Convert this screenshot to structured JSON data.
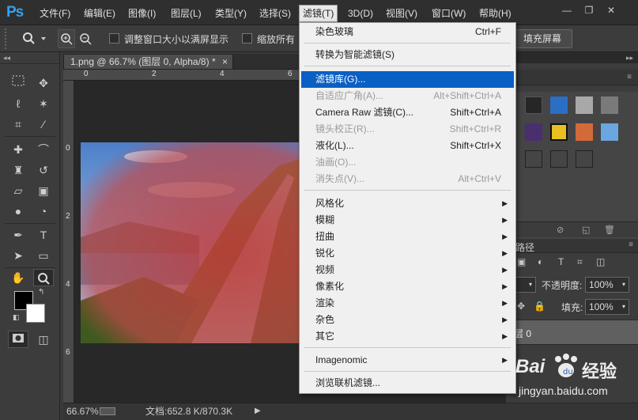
{
  "app": {
    "logo": "Ps"
  },
  "menubar": {
    "items": [
      {
        "label": "文件(F)"
      },
      {
        "label": "编辑(E)"
      },
      {
        "label": "图像(I)"
      },
      {
        "label": "图层(L)"
      },
      {
        "label": "类型(Y)"
      },
      {
        "label": "选择(S)"
      },
      {
        "label": "滤镜(T)",
        "active": true
      },
      {
        "label": "3D(D)"
      },
      {
        "label": "视图(V)"
      },
      {
        "label": "窗口(W)"
      },
      {
        "label": "帮助(H)"
      }
    ]
  },
  "window_controls": {
    "minimize": "—",
    "restore": "❐",
    "close": "✕"
  },
  "options": {
    "resize_window_label": "调整窗口大小以满屏显示",
    "zoom_all_label": "缩放所有",
    "fill_screen_label": "填充屏幕"
  },
  "document": {
    "tab_title": "1.png @ 66.7% (图层 0, Alpha/8) *",
    "tab_close": "×",
    "ruler_top": [
      "0",
      "2",
      "4",
      "6"
    ],
    "ruler_left": [
      "0",
      "2",
      "4",
      "6",
      "8"
    ]
  },
  "status": {
    "zoom": "66.67%",
    "doc_size": "文档:652.8 K/870.3K",
    "arrow": "▶"
  },
  "layers_panel": {
    "tab_partial": "路径",
    "opacity_label": "不透明度:",
    "opacity_value": "100%",
    "fill_label": "填充:",
    "fill_value": "100%",
    "layer_name_partial": "层 0"
  },
  "filter_menu": {
    "items": [
      {
        "label": "染色玻璃",
        "shortcut": "Ctrl+F",
        "disabled": false
      },
      {
        "sep": true
      },
      {
        "label": "转换为智能滤镜(S)",
        "shortcut": "",
        "disabled": false
      },
      {
        "sep": true
      },
      {
        "label": "滤镜库(G)...",
        "shortcut": "",
        "disabled": false,
        "highlight": true
      },
      {
        "label": "自适应广角(A)...",
        "shortcut": "Alt+Shift+Ctrl+A",
        "disabled": true
      },
      {
        "label": "Camera Raw 滤镜(C)...",
        "shortcut": "Shift+Ctrl+A",
        "disabled": false
      },
      {
        "label": "镜头校正(R)...",
        "shortcut": "Shift+Ctrl+R",
        "disabled": true
      },
      {
        "label": "液化(L)...",
        "shortcut": "Shift+Ctrl+X",
        "disabled": false
      },
      {
        "label": "油画(O)...",
        "shortcut": "",
        "disabled": true
      },
      {
        "label": "消失点(V)...",
        "shortcut": "Alt+Ctrl+V",
        "disabled": true
      },
      {
        "sep": true
      },
      {
        "label": "风格化",
        "submenu": true
      },
      {
        "label": "模糊",
        "submenu": true
      },
      {
        "label": "扭曲",
        "submenu": true
      },
      {
        "label": "锐化",
        "submenu": true
      },
      {
        "label": "视频",
        "submenu": true
      },
      {
        "label": "像素化",
        "submenu": true
      },
      {
        "label": "渲染",
        "submenu": true
      },
      {
        "label": "杂色",
        "submenu": true
      },
      {
        "label": "其它",
        "submenu": true
      },
      {
        "sep": true
      },
      {
        "label": "Imagenomic",
        "submenu": true
      },
      {
        "sep": true
      },
      {
        "label": "浏览联机滤镜...",
        "shortcut": "",
        "disabled": false
      }
    ]
  },
  "watermark": {
    "brand": "Bai",
    "brand2": "经验",
    "url": "jingyan.baidu.com"
  },
  "colors": {
    "highlight": "#0a5fc4",
    "ps_blue": "#2fa3f0"
  }
}
